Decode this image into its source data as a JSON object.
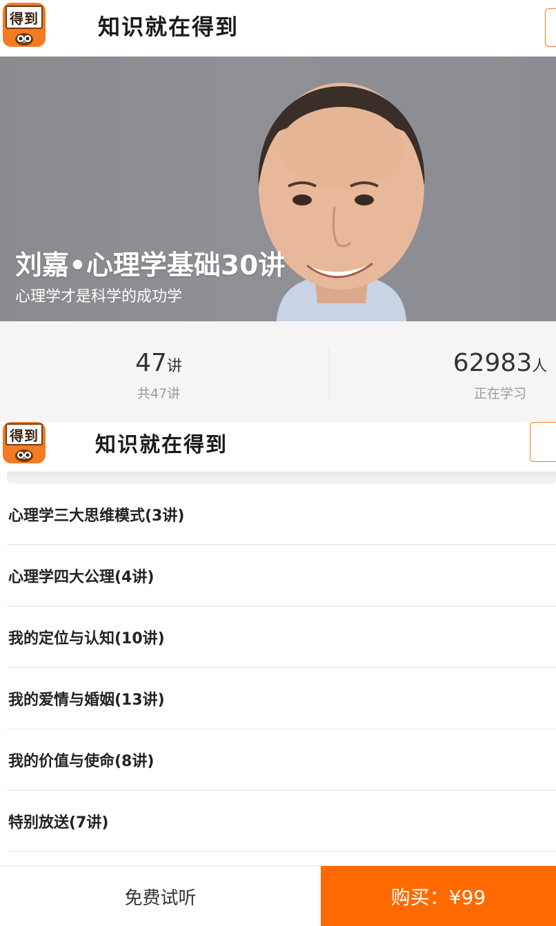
{
  "app": {
    "logo_text": "得到",
    "slogan": "知识就在得到"
  },
  "course": {
    "title": "刘嘉•心理学基础30讲",
    "subtitle": "心理学才是科学的成功学"
  },
  "stats": {
    "lectures_num": "47",
    "lectures_unit": "讲",
    "lectures_label": "共47讲",
    "learners_num": "62983",
    "learners_unit": "人",
    "learners_label": "正在学习"
  },
  "chapters": [
    {
      "title": "心理学三大思维模式(3讲)"
    },
    {
      "title": "心理学四大公理(4讲)"
    },
    {
      "title": "我的定位与认知(10讲)"
    },
    {
      "title": "我的爱情与婚姻(13讲)"
    },
    {
      "title": "我的价值与使命(8讲)"
    },
    {
      "title": "特别放送(7讲)"
    }
  ],
  "bottom": {
    "trial_label": "免费试听",
    "buy_label": "购买：¥99"
  },
  "colors": {
    "accent": "#ff6a00",
    "logo_orange": "#f47b20"
  }
}
